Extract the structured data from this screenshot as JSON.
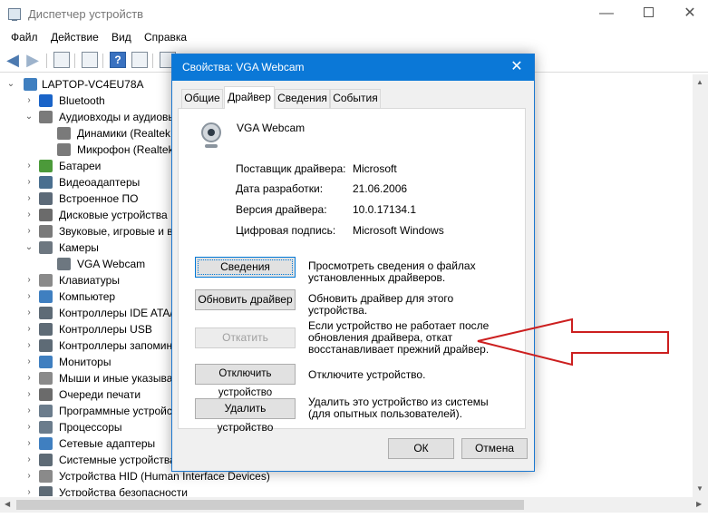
{
  "window": {
    "title": "Диспетчер устройств",
    "minimize": "—",
    "close": "✕"
  },
  "menu": [
    "Файл",
    "Действие",
    "Вид",
    "Справка"
  ],
  "tree": {
    "root": "LAPTOP-VC4EU78A",
    "items": [
      {
        "label": "Bluetooth",
        "level": 1,
        "expander": "›",
        "icon": "bluetooth-icon",
        "color": "#1a64c8"
      },
      {
        "label": "Аудиовходы и аудиовы",
        "level": 1,
        "expander": "⌄",
        "icon": "audio-icon",
        "color": "#7a7a7a"
      },
      {
        "label": "Динамики (Realtek",
        "level": 2,
        "expander": "",
        "icon": "speaker-icon",
        "color": "#7a7a7a"
      },
      {
        "label": "Микрофон (Realtek",
        "level": 2,
        "expander": "",
        "icon": "microphone-icon",
        "color": "#7a7a7a"
      },
      {
        "label": "Батареи",
        "level": 1,
        "expander": "›",
        "icon": "battery-icon",
        "color": "#4c9a3a"
      },
      {
        "label": "Видеоадаптеры",
        "level": 1,
        "expander": "›",
        "icon": "display-adapter-icon",
        "color": "#4a6f8f"
      },
      {
        "label": "Встроенное ПО",
        "level": 1,
        "expander": "›",
        "icon": "firmware-icon",
        "color": "#5c6a78"
      },
      {
        "label": "Дисковые устройства",
        "level": 1,
        "expander": "›",
        "icon": "disk-icon",
        "color": "#6b6b6b"
      },
      {
        "label": "Звуковые, игровые и в",
        "level": 1,
        "expander": "›",
        "icon": "sound-icon",
        "color": "#7a7a7a"
      },
      {
        "label": "Камеры",
        "level": 1,
        "expander": "⌄",
        "icon": "camera-icon",
        "color": "#6d7780"
      },
      {
        "label": "VGA Webcam",
        "level": 2,
        "expander": "",
        "icon": "webcam-icon",
        "color": "#6d7780"
      },
      {
        "label": "Клавиатуры",
        "level": 1,
        "expander": "›",
        "icon": "keyboard-icon",
        "color": "#8a8a8a"
      },
      {
        "label": "Компьютер",
        "level": 1,
        "expander": "›",
        "icon": "computer-icon",
        "color": "#3f7fc0"
      },
      {
        "label": "Контроллеры IDE ATA/",
        "level": 1,
        "expander": "›",
        "icon": "ide-controller-icon",
        "color": "#5e6b76"
      },
      {
        "label": "Контроллеры USB",
        "level": 1,
        "expander": "›",
        "icon": "usb-icon",
        "color": "#5e6b76"
      },
      {
        "label": "Контроллеры запомин",
        "level": 1,
        "expander": "›",
        "icon": "storage-controller-icon",
        "color": "#5e6b76"
      },
      {
        "label": "Мониторы",
        "level": 1,
        "expander": "›",
        "icon": "monitor-icon",
        "color": "#3f7fc0"
      },
      {
        "label": "Мыши и иные указыва",
        "level": 1,
        "expander": "›",
        "icon": "mouse-icon",
        "color": "#8a8a8a"
      },
      {
        "label": "Очереди печати",
        "level": 1,
        "expander": "›",
        "icon": "printer-icon",
        "color": "#6b6b6b"
      },
      {
        "label": "Программные устройс",
        "level": 1,
        "expander": "›",
        "icon": "software-device-icon",
        "color": "#6b7c8c"
      },
      {
        "label": "Процессоры",
        "level": 1,
        "expander": "›",
        "icon": "processor-icon",
        "color": "#6b7c8c"
      },
      {
        "label": "Сетевые адаптеры",
        "level": 1,
        "expander": "›",
        "icon": "network-adapter-icon",
        "color": "#3f7fc0"
      },
      {
        "label": "Системные устройства",
        "level": 1,
        "expander": "›",
        "icon": "system-device-icon",
        "color": "#5e6b76"
      },
      {
        "label": "Устройства HID (Human Interface Devices)",
        "level": 1,
        "expander": "›",
        "icon": "hid-icon",
        "color": "#8a8a8a"
      },
      {
        "label": "Устройства безопасности",
        "level": 1,
        "expander": "›",
        "icon": "security-device-icon",
        "color": "#5e6b76"
      }
    ]
  },
  "dialog": {
    "title": "Свойства: VGA Webcam",
    "close": "✕",
    "tabs": [
      "Общие",
      "Драйвер",
      "Сведения",
      "События"
    ],
    "active_tab": "Драйвер",
    "device_name": "VGA Webcam",
    "properties": [
      {
        "label": "Поставщик драйвера:",
        "value": "Microsoft"
      },
      {
        "label": "Дата разработки:",
        "value": "21.06.2006"
      },
      {
        "label": "Версия драйвера:",
        "value": "10.0.17134.1"
      },
      {
        "label": "Цифровая подпись:",
        "value": "Microsoft Windows"
      }
    ],
    "actions": [
      {
        "label": "Сведения",
        "description": "Просмотреть сведения о файлах установленных драйверов.",
        "state": "focused"
      },
      {
        "label": "Обновить драйвер",
        "description": "Обновить драйвер для этого устройства.",
        "state": "normal"
      },
      {
        "label": "Откатить",
        "description": "Если устройство не работает после обновления драйвера, откат восстанавливает прежний драйвер.",
        "state": "disabled"
      },
      {
        "label": "Отключить устройство",
        "description": "Отключите устройство.",
        "state": "normal"
      },
      {
        "label": "Удалить устройство",
        "description": "Удалить это устройство из системы (для опытных пользователей).",
        "state": "normal"
      }
    ],
    "ok": "ОК",
    "cancel": "Отмена"
  },
  "annotation_arrow_color": "#cc1f1f"
}
